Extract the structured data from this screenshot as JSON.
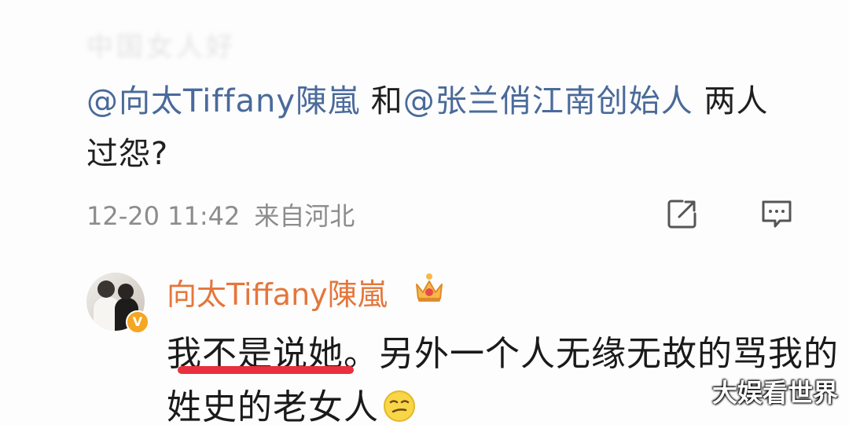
{
  "post": {
    "faded_text": "中国女人好",
    "mention1": "@向太Tiffany陳嵐",
    "conj": " 和",
    "mention2": "@张兰俏江南创始人",
    "text_cont": " 两人",
    "text_line2": "过怨?",
    "timestamp": "12-20 11:42",
    "location": "来自河北"
  },
  "icons": {
    "share": "share-edit-icon",
    "comment": "comment-icon",
    "crown": "crown-badge-icon",
    "verified": "verified-v-icon",
    "emoji": "smirk-emoji-icon"
  },
  "reply": {
    "username": "向太Tiffany陳嵐",
    "verified_letter": "V",
    "line1_underlined": "我不是说她",
    "line1_rest": "。另外一个人无缘无故的骂我的",
    "line2": "姓史的老女人"
  },
  "watermark": "大娱看世界",
  "colors": {
    "mention": "#4a6a9a",
    "username": "#e5763b",
    "underline": "#e8303f",
    "meta": "#8c8c8c"
  }
}
